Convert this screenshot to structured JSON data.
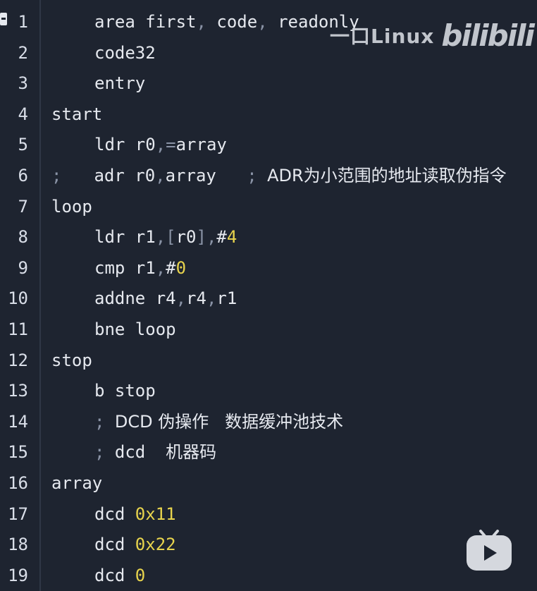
{
  "watermark": {
    "text": "一口Linux",
    "logo": "bilibili"
  },
  "lines": [
    {
      "n": "1",
      "parts": [
        [
          "ind",
          ""
        ],
        [
          "t",
          "area first"
        ],
        [
          "p",
          ","
        ],
        [
          "t",
          " code"
        ],
        [
          "p",
          ","
        ],
        [
          "t",
          " readonly"
        ]
      ]
    },
    {
      "n": "2",
      "parts": [
        [
          "ind",
          ""
        ],
        [
          "t",
          "code32"
        ]
      ]
    },
    {
      "n": "3",
      "parts": [
        [
          "ind",
          ""
        ],
        [
          "t",
          "entry"
        ]
      ]
    },
    {
      "n": "4",
      "parts": [
        [
          "t",
          "start"
        ]
      ]
    },
    {
      "n": "5",
      "parts": [
        [
          "ind",
          ""
        ],
        [
          "t",
          "ldr r0"
        ],
        [
          "p",
          ","
        ],
        [
          "p",
          "="
        ],
        [
          "t",
          "array"
        ]
      ]
    },
    {
      "n": "6",
      "parts": [
        [
          "c",
          ";"
        ],
        [
          "ind2",
          ""
        ],
        [
          "t",
          "adr r0"
        ],
        [
          "p",
          ","
        ],
        [
          "t",
          "array   "
        ],
        [
          "c",
          "; "
        ],
        [
          "j",
          "ADR为小范围的地址读取伪指令"
        ]
      ]
    },
    {
      "n": "7",
      "parts": [
        [
          "t",
          "loop"
        ]
      ]
    },
    {
      "n": "8",
      "parts": [
        [
          "ind",
          ""
        ],
        [
          "t",
          "ldr r1"
        ],
        [
          "p",
          ",["
        ],
        [
          "t",
          "r0"
        ],
        [
          "p",
          "],"
        ],
        [
          "t",
          "#"
        ],
        [
          "num",
          "4"
        ]
      ]
    },
    {
      "n": "9",
      "parts": [
        [
          "ind",
          ""
        ],
        [
          "t",
          "cmp r1"
        ],
        [
          "p",
          ","
        ],
        [
          "t",
          "#"
        ],
        [
          "num",
          "0"
        ]
      ]
    },
    {
      "n": "10",
      "parts": [
        [
          "ind",
          ""
        ],
        [
          "t",
          "addne r4"
        ],
        [
          "p",
          ","
        ],
        [
          "t",
          "r4"
        ],
        [
          "p",
          ","
        ],
        [
          "t",
          "r1"
        ]
      ]
    },
    {
      "n": "11",
      "parts": [
        [
          "ind",
          ""
        ],
        [
          "t",
          "bne loop"
        ]
      ]
    },
    {
      "n": "12",
      "parts": [
        [
          "t",
          "stop"
        ]
      ]
    },
    {
      "n": "13",
      "parts": [
        [
          "ind",
          ""
        ],
        [
          "t",
          "b stop"
        ]
      ]
    },
    {
      "n": "14",
      "parts": [
        [
          "ind",
          ""
        ],
        [
          "c",
          "; "
        ],
        [
          "j",
          "DCD 伪操作   数据缓冲池技术"
        ]
      ]
    },
    {
      "n": "15",
      "parts": [
        [
          "ind",
          ""
        ],
        [
          "c",
          "; "
        ],
        [
          "t",
          "dcd  "
        ],
        [
          "j",
          "机器码"
        ]
      ]
    },
    {
      "n": "16",
      "parts": [
        [
          "t",
          "array"
        ]
      ]
    },
    {
      "n": "17",
      "parts": [
        [
          "ind",
          ""
        ],
        [
          "t",
          "dcd "
        ],
        [
          "num",
          "0x11"
        ]
      ]
    },
    {
      "n": "18",
      "parts": [
        [
          "ind",
          ""
        ],
        [
          "t",
          "dcd "
        ],
        [
          "num",
          "0x22"
        ]
      ]
    },
    {
      "n": "19",
      "parts": [
        [
          "ind",
          ""
        ],
        [
          "t",
          "dcd "
        ],
        [
          "num",
          "0"
        ]
      ]
    }
  ]
}
